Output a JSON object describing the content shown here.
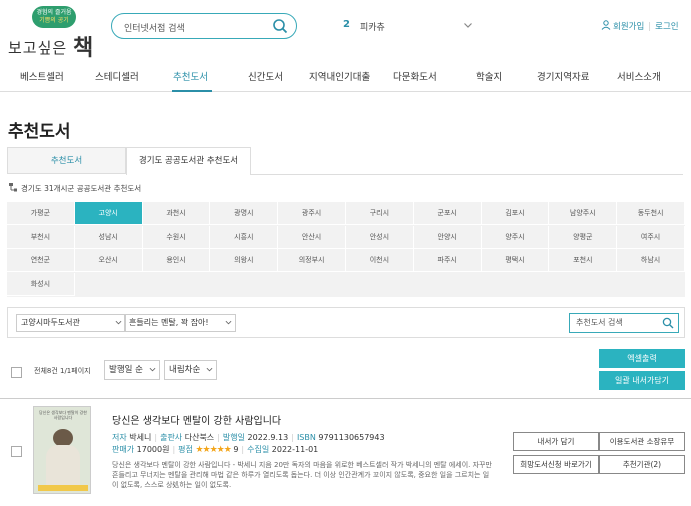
{
  "header": {
    "logo_badge_line1": "경험의 즐거움",
    "logo_badge_line2": "기쁨의 공기",
    "logo_text": "보고싶은",
    "logo_text_bold": "책",
    "search_placeholder": "인터넷서점 검색",
    "rank_number": "2",
    "rank_keyword": "피카츄",
    "signup": "회원가입",
    "login": "로그인"
  },
  "nav": {
    "items": [
      "베스트셀러",
      "스테디셀러",
      "추천도서",
      "신간도서",
      "지역내인기대출",
      "다문화도서",
      "학술지",
      "경기지역자료",
      "서비스소개"
    ],
    "active": "추천도서"
  },
  "page_title": "추천도서",
  "tabs": [
    "추천도서",
    "경기도 공공도서관 추천도서"
  ],
  "subhead": "경기도 31개시군 공공도서관 추천도서",
  "cities": [
    "가평군",
    "고양시",
    "과천시",
    "광명시",
    "광주시",
    "구리시",
    "군포시",
    "김포시",
    "남양주시",
    "동두천시",
    "부천시",
    "성남시",
    "수원시",
    "시흥시",
    "안산시",
    "안성시",
    "안양시",
    "양주시",
    "양평군",
    "여주시",
    "연천군",
    "오산시",
    "용인시",
    "의왕시",
    "의정부시",
    "이천시",
    "파주시",
    "평택시",
    "포천시",
    "하남시",
    "화성시"
  ],
  "active_city": "고양시",
  "filter": {
    "library": "고양시마두도서관",
    "book_select": "흔들리는 멘탈, 꽉 잡아!",
    "search_placeholder": "추천도서 검색"
  },
  "list": {
    "total": "전체8건 1/1페이지",
    "sort1": "발행일 순",
    "sort2": "내림차순",
    "excel_btn": "엑셀출력",
    "bulk_btn": "일괄 내서가담기"
  },
  "book": {
    "cover_title": "당신은 생각보다 멘탈이 강한 사람입니다",
    "title": "당신은 생각보다 멘탈이 강한 사람입니다",
    "author_label": "저자",
    "author": "박세니",
    "publisher_label": "출판사",
    "publisher": "다산북스",
    "pubdate_label": "발행일",
    "pubdate": "2022.9.13",
    "isbn_label": "ISBN",
    "isbn": "9791130657943",
    "price_label": "판매가",
    "price": "17000원",
    "rating_label": "평점",
    "rating_stars": 4.5,
    "rating_display": "★★★★★",
    "rating_count": "9",
    "collected_label": "수집일",
    "collected": "2022-11-01",
    "desc": "당신은 생각보다 멘탈이 강한 사람입니다 - 박세니 지음 20만 독자의 마음을 위로한 베스트셀러 작가 박세니의 멘탈 에세이. 자꾸만 흔들리고 무너지는 멘탈을 관리해 마법 같은 하루가 열리도록 돕는다. 더 이상 인간관계가 꼬이지 않도록, 중요한 일을 그르치는 일이 없도록, 스스로 상処하는 일이 없도록.",
    "buttons": [
      "내서가 담기",
      "이용도서관 소장유무",
      "희망도서신청 바로가기",
      "추천기관(2)"
    ]
  },
  "colors": {
    "accent": "#2bb3c0",
    "link": "#2b8fa8",
    "star": "#f3a51a"
  }
}
